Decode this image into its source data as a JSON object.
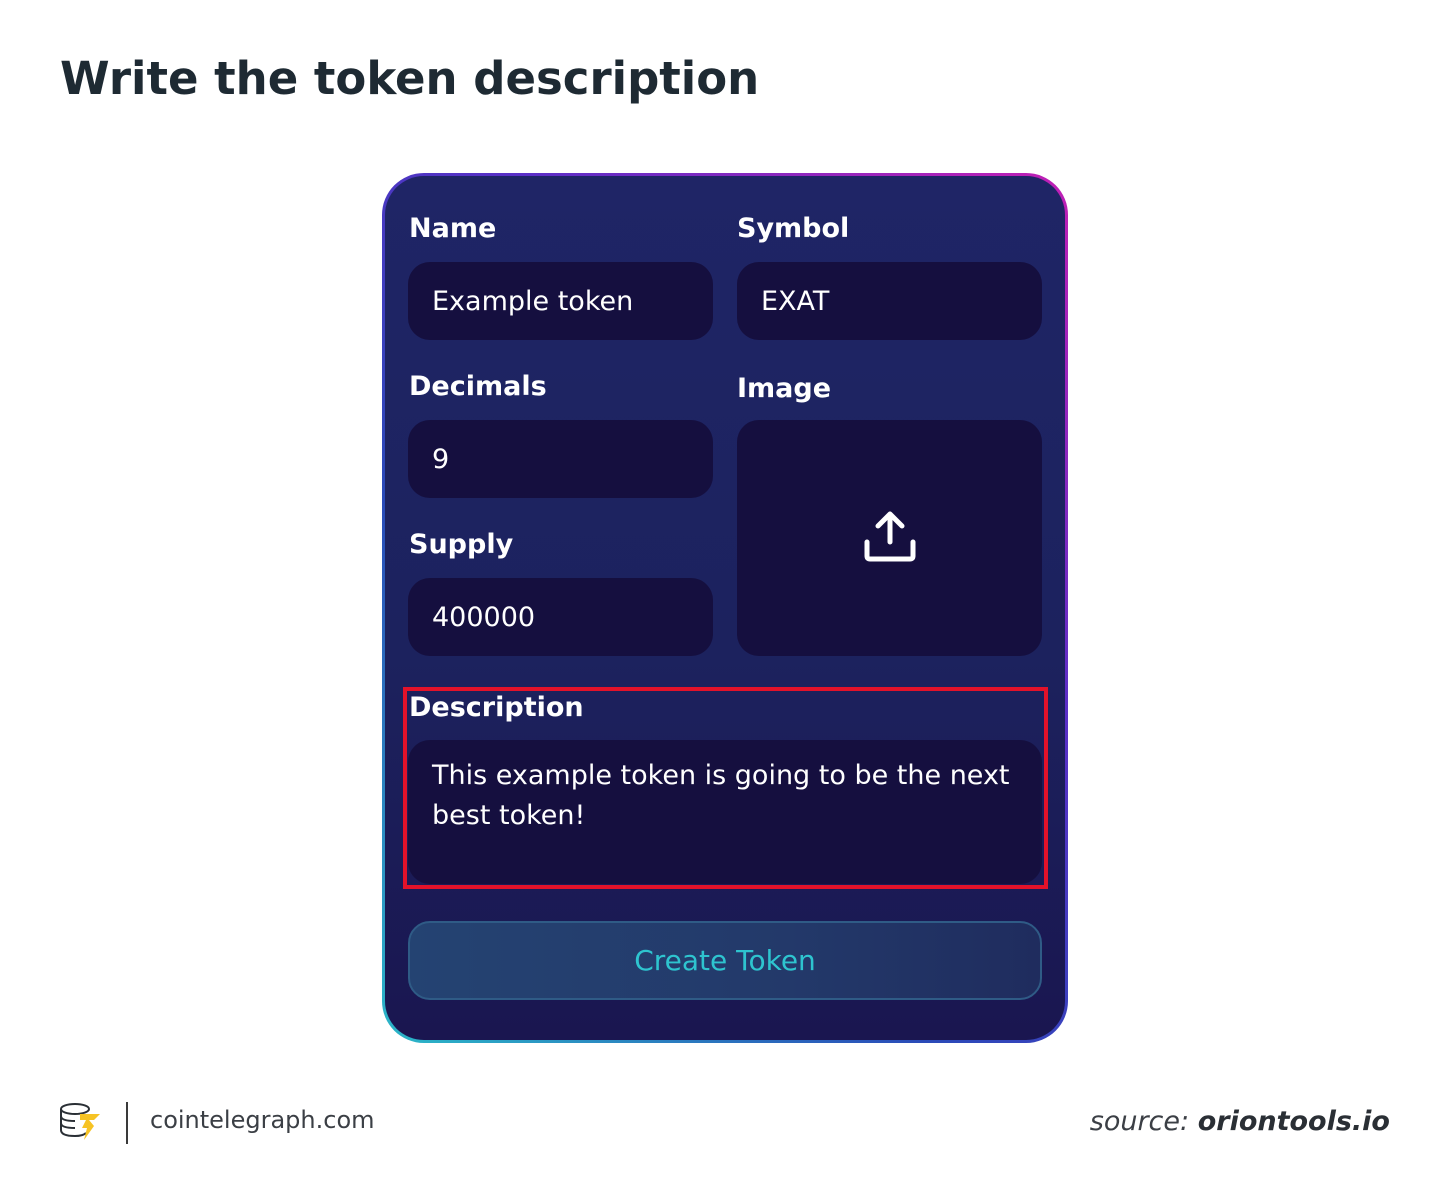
{
  "page": {
    "title": "Write the token description"
  },
  "form": {
    "name": {
      "label": "Name",
      "value": "Example token"
    },
    "symbol": {
      "label": "Symbol",
      "value": "EXAT"
    },
    "decimals": {
      "label": "Decimals",
      "value": "9"
    },
    "image": {
      "label": "Image",
      "icon": "upload-icon"
    },
    "supply": {
      "label": "Supply",
      "value": "400000"
    },
    "description": {
      "label": "Description",
      "value": "This example token is going to be the next best token!"
    },
    "create_button": "Create Token"
  },
  "colors": {
    "highlight": "#e3122a",
    "card_background": "#1f2566",
    "field_background": "#150f3f",
    "button_text": "#2ec4cf"
  },
  "footer": {
    "site": "cointelegraph.com",
    "source_prefix": "source:",
    "source_name": "oriontools.io"
  }
}
